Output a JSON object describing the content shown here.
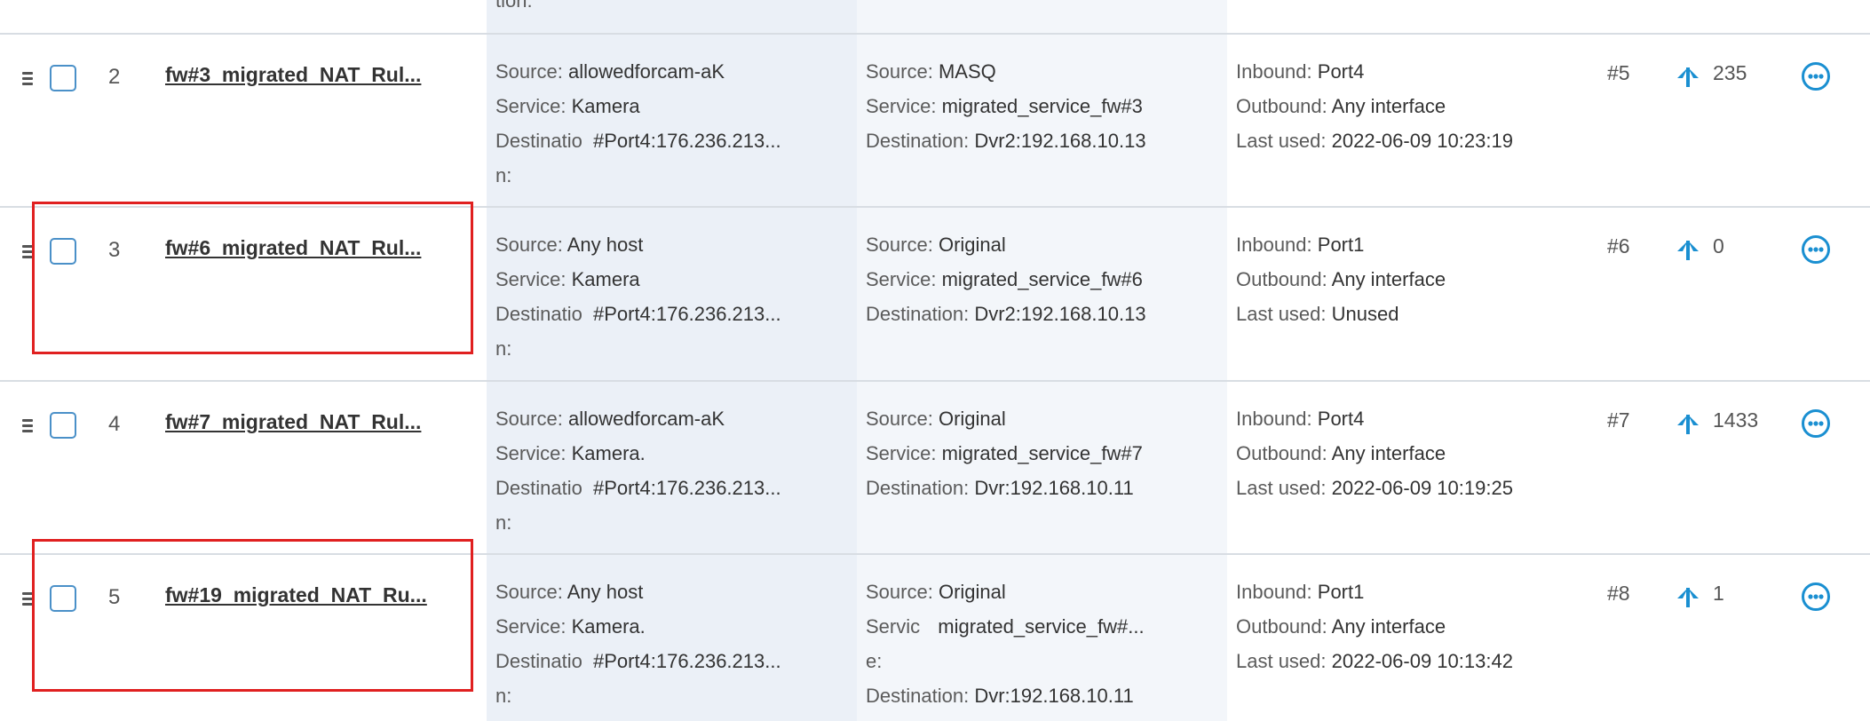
{
  "partial_top_text": "tion:",
  "labels": {
    "source": "Source:",
    "service": "Service:",
    "destination": "Destination:",
    "destination_line1": "Destinatio",
    "destination_line2": "n:",
    "service_line1": "Servic",
    "service_line2": "e:",
    "inbound": "Inbound:",
    "outbound": "Outbound:",
    "last_used": "Last used:"
  },
  "rows": [
    {
      "number": "2",
      "name": "fw#3_migrated_NAT_Rul...",
      "original": {
        "source": "allowedforcam-aK",
        "service": "Kamera",
        "destination": "#Port4:176.236.213..."
      },
      "translated": {
        "source": "MASQ",
        "service": "migrated_service_fw#3",
        "destination": "Dvr2:192.168.10.13"
      },
      "inbound": "Port4",
      "outbound": "Any interface",
      "last_used": "2022-06-09 10:23:19",
      "order": "#5",
      "hits": "235"
    },
    {
      "number": "3",
      "name": "fw#6_migrated_NAT_Rul...",
      "original": {
        "source": "Any host",
        "service": "Kamera",
        "destination": "#Port4:176.236.213..."
      },
      "translated": {
        "source": "Original",
        "service": "migrated_service_fw#6",
        "destination": "Dvr2:192.168.10.13"
      },
      "inbound": "Port1",
      "outbound": "Any interface",
      "last_used": "Unused",
      "order": "#6",
      "hits": "0"
    },
    {
      "number": "4",
      "name": "fw#7_migrated_NAT_Rul...",
      "original": {
        "source": "allowedforcam-aK",
        "service": "Kamera.",
        "destination": "#Port4:176.236.213..."
      },
      "translated": {
        "source": "Original",
        "service": "migrated_service_fw#7",
        "destination": "Dvr:192.168.10.11"
      },
      "inbound": "Port4",
      "outbound": "Any interface",
      "last_used": "2022-06-09 10:19:25",
      "order": "#7",
      "hits": "1433"
    },
    {
      "number": "5",
      "name": "fw#19_migrated_NAT_Ru...",
      "original": {
        "source": "Any host",
        "service": "Kamera.",
        "destination": "#Port4:176.236.213..."
      },
      "translated": {
        "source": "Original",
        "service": "migrated_service_fw#...",
        "destination": "Dvr:192.168.10.11"
      },
      "inbound": "Port1",
      "outbound": "Any interface",
      "last_used": "2022-06-09 10:13:42",
      "order": "#8",
      "hits": "1"
    }
  ],
  "colors": {
    "accent": "#1a8fd1",
    "highlight": "#e02020",
    "original_column_bg": "#ebf0f7",
    "translated_column_bg": "#f3f6fa",
    "row_separator": "#d8dde3"
  },
  "icons": {
    "drag": "drag-handle-icon",
    "hits": "hit-counter-icon",
    "menu": "more-options-icon"
  }
}
